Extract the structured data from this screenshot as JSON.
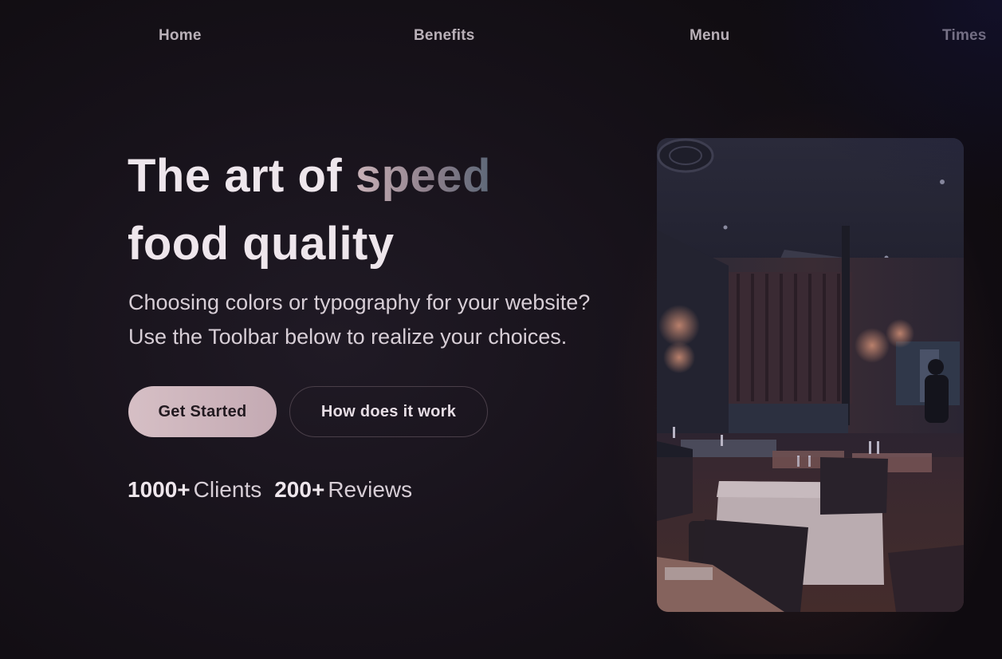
{
  "nav": {
    "items": [
      "Home",
      "Benefits",
      "Menu",
      "Times"
    ]
  },
  "hero": {
    "title_part1": "The art of ",
    "title_accent": "speed",
    "title_line2": "food quality",
    "subtitle_line1": "Choosing colors or typography for your website?",
    "subtitle_line2": "Use the Toolbar below to realize your choices."
  },
  "buttons": {
    "primary_label": "Get Started",
    "secondary_label": "How does it work"
  },
  "stats": [
    {
      "value": "1000+",
      "label": "Clients"
    },
    {
      "value": "200+",
      "label": "Reviews"
    }
  ],
  "colors": {
    "background": "#17121a",
    "accent_button": "#d6bfc5",
    "text_primary": "#eee6ec"
  }
}
